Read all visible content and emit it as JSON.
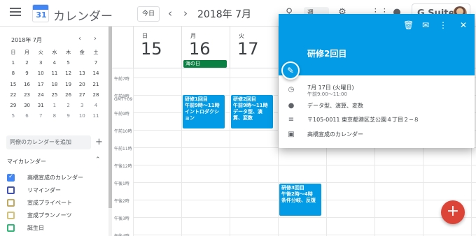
{
  "header": {
    "app_title": "カレンダー",
    "logo_num": "31",
    "today_label": "今日",
    "prev_arrow": "‹",
    "next_arrow": "›",
    "month_title": "2018年 7月",
    "view_label": "週",
    "gsuite_label": "G Suite"
  },
  "sidebar": {
    "mini_title": "2018年 7月",
    "weekdays": [
      "日",
      "月",
      "火",
      "水",
      "木",
      "金",
      "土"
    ],
    "weeks": [
      [
        "1",
        "2",
        "3",
        "4",
        "5",
        "6",
        "7"
      ],
      [
        "8",
        "9",
        "10",
        "11",
        "12",
        "13",
        "14"
      ],
      [
        "15",
        "16",
        "17",
        "18",
        "19",
        "20",
        "21"
      ],
      [
        "22",
        "23",
        "24",
        "25",
        "26",
        "27",
        "28"
      ],
      [
        "29",
        "30",
        "31",
        "1",
        "2",
        "3",
        "4"
      ],
      [
        "5",
        "6",
        "7",
        "8",
        "9",
        "10",
        "11"
      ]
    ],
    "today": "6",
    "selected": "20",
    "add_placeholder": "同僚のカレンダーを追加",
    "add_plus": "+",
    "my_calendars_label": "マイカレンダー",
    "calendars": [
      {
        "label": "高橋宣成のカレンダー",
        "color": "#4285f4",
        "checked": true
      },
      {
        "label": "リマインダー",
        "color": "#3f51b5",
        "checked": false
      },
      {
        "label": "宣成プライベート",
        "color": "#c0a962",
        "checked": false
      },
      {
        "label": "宣成プランノーツ",
        "color": "#d4c27a",
        "checked": false
      },
      {
        "label": "誕生日",
        "color": "#33b679",
        "checked": false
      }
    ]
  },
  "days": [
    {
      "dow": "日",
      "num": "15"
    },
    {
      "dow": "月",
      "num": "16"
    },
    {
      "dow": "火",
      "num": "17"
    }
  ],
  "allday_event": "海の日",
  "gmt_label": "GMT+09",
  "hours": [
    "午前7時",
    "午前8時",
    "午前9時",
    "午前10時",
    "午前11時",
    "午後12時",
    "午後1時",
    "午後2時",
    "午後3時",
    "午後4時"
  ],
  "events": [
    {
      "title": "研修1回目",
      "time": "午前9時～11時",
      "detail1": "イントロダクシ",
      "detail2": "ョン"
    },
    {
      "title": "研修2回目",
      "time": "午前9時～11時",
      "detail1": "データ型、演",
      "detail2": "算、変数"
    },
    {
      "title": "研修3回目",
      "time": "午後2時～4時",
      "detail1": "条件分岐、反復",
      "detail2": ""
    }
  ],
  "fab": "+",
  "popup": {
    "title": "研修2回目",
    "date": "7月 17日 (火曜日)",
    "time": "午前9:00～11:00",
    "description": "データ型、演算、変数",
    "location": "〒105-0011 東京都港区芝公園４丁目２−８",
    "calendar": "高橋宣成のカレンダー"
  }
}
